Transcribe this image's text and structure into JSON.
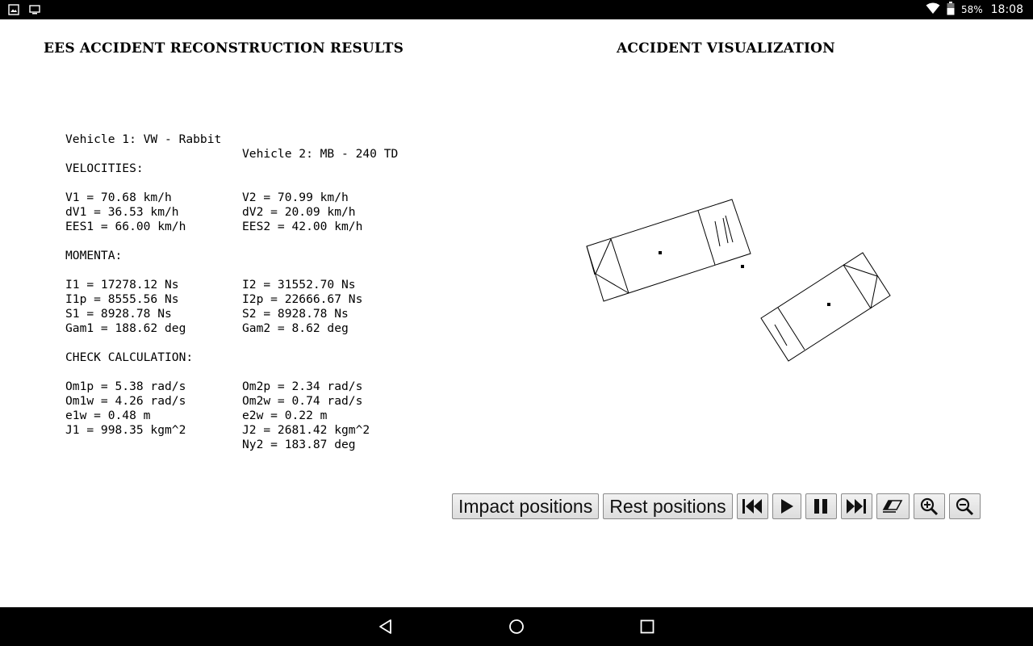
{
  "status_bar": {
    "left_icons": [
      "image-icon",
      "cast-icon"
    ],
    "battery_percent": "58%",
    "time": "18:08"
  },
  "results": {
    "title": "EES ACCIDENT RECONSTRUCTION RESULTS",
    "vehicle1": "Vehicle 1: VW - Rabbit",
    "vehicle2": "Vehicle 2: MB - 240 TD",
    "velocities_header": "VELOCITIES:",
    "velocities": [
      [
        "V1 = 70.68 km/h",
        "V2 = 70.99 km/h"
      ],
      [
        "dV1 = 36.53 km/h",
        "dV2 = 20.09 km/h"
      ],
      [
        "EES1 = 66.00 km/h",
        "EES2 = 42.00 km/h"
      ]
    ],
    "momenta_header": "MOMENTA:",
    "momenta": [
      [
        "I1 = 17278.12 Ns",
        "I2 = 31552.70 Ns"
      ],
      [
        "I1p = 8555.56 Ns",
        "I2p = 22666.67 Ns"
      ],
      [
        "S1 = 8928.78 Ns",
        "S2 = 8928.78 Ns"
      ],
      [
        "Gam1 = 188.62 deg",
        "Gam2 = 8.62 deg"
      ]
    ],
    "check_header": "CHECK CALCULATION:",
    "check": [
      [
        "Om1p = 5.38 rad/s",
        "Om2p = 2.34 rad/s"
      ],
      [
        "Om1w = 4.26 rad/s",
        "Om2w = 0.74 rad/s"
      ],
      [
        "e1w = 0.48 m",
        "e2w = 0.22 m"
      ],
      [
        "J1 = 998.35 kgm^2",
        "J2 = 2681.42 kgm^2"
      ],
      [
        "",
        "Ny2 = 183.87 deg"
      ]
    ]
  },
  "visualization": {
    "title": "ACCIDENT VISUALIZATION"
  },
  "controls": {
    "impact_label": "Impact positions",
    "rest_label": "Rest positions",
    "icons": [
      "skip-back-icon",
      "play-icon",
      "pause-icon",
      "skip-forward-icon",
      "eraser-icon",
      "zoom-in-icon",
      "zoom-out-icon"
    ]
  },
  "nav_bar": {
    "icons": [
      "back-icon",
      "home-icon",
      "recents-icon"
    ]
  }
}
